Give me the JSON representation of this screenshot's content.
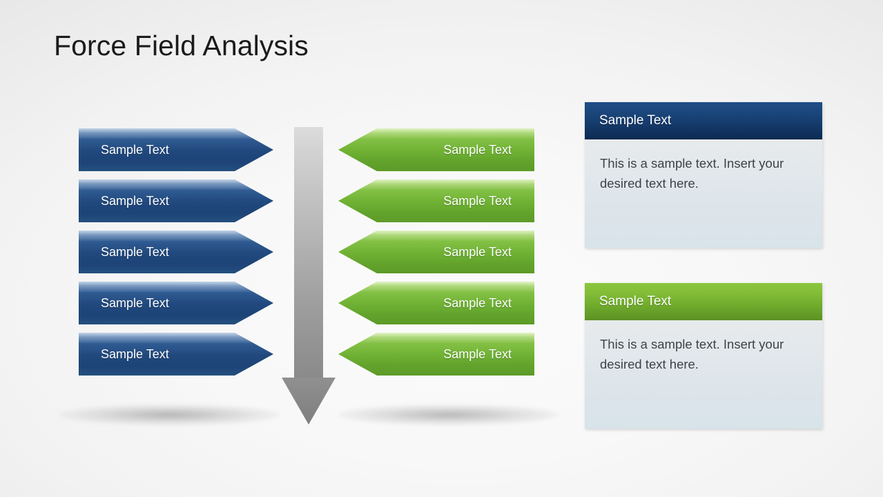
{
  "slide": {
    "title": "Force Field Analysis",
    "background_color": "#f2f2f2"
  },
  "colors": {
    "blue_arrow": "#21497e",
    "blue_arrow_light": "#7b9ac4",
    "green_arrow": "#72b436",
    "green_arrow_light": "#b7dd7f",
    "gray_arrow_top": "#d4d4d4",
    "gray_arrow_bottom": "#8a8a8a",
    "panel_header_blue": "#123563",
    "panel_header_green": "#82bd37",
    "panel_body": "#dde5ea",
    "title_text": "#1b1b1b",
    "body_text": "#3b4346"
  },
  "driving_forces": {
    "name": "driving-forces-column",
    "direction": "right",
    "items": [
      {
        "label": "Sample Text"
      },
      {
        "label": "Sample Text"
      },
      {
        "label": "Sample Text"
      },
      {
        "label": "Sample Text"
      },
      {
        "label": "Sample Text"
      }
    ]
  },
  "restraining_forces": {
    "name": "restraining-forces-column",
    "direction": "left",
    "items": [
      {
        "label": "Sample Text"
      },
      {
        "label": "Sample Text"
      },
      {
        "label": "Sample Text"
      },
      {
        "label": "Sample Text"
      },
      {
        "label": "Sample Text"
      }
    ]
  },
  "center_arrow": {
    "name": "down-arrow",
    "direction": "down"
  },
  "panels": [
    {
      "name": "panel-blue",
      "header": "Sample Text",
      "body": "This is a sample text. Insert your desired text here.",
      "accent": "#123563"
    },
    {
      "name": "panel-green",
      "header": "Sample Text",
      "body": "This is a sample text. Insert your desired text here.",
      "accent": "#82bd37"
    }
  ]
}
